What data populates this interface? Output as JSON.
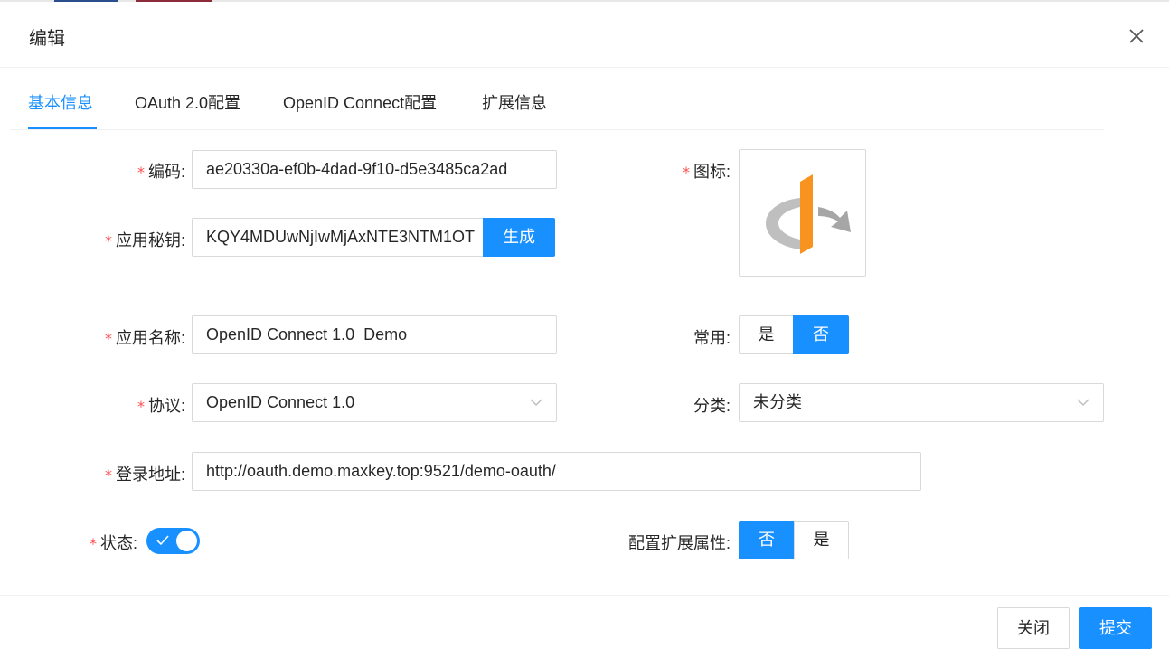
{
  "modal": {
    "title": "编辑"
  },
  "tabs": [
    {
      "label": "基本信息",
      "active": true
    },
    {
      "label": "OAuth 2.0配置"
    },
    {
      "label": "OpenID Connect配置"
    },
    {
      "label": "扩展信息"
    }
  ],
  "form": {
    "required_mark": "*",
    "code": {
      "label": "编码:",
      "value": "ae20330a-ef0b-4dad-9f10-d5e3485ca2ad"
    },
    "secret": {
      "label": "应用秘钥:",
      "value": "KQY4MDUwNjIwMjAxNTE3NTM1OT",
      "generate_label": "生成"
    },
    "icon": {
      "label": "图标:",
      "icon_name": "openid-logo-icon"
    },
    "app_name": {
      "label": "应用名称:",
      "value": "OpenID Connect 1.0  Demo"
    },
    "common": {
      "label": "常用:",
      "options": [
        "是",
        "否"
      ],
      "selected": "否"
    },
    "protocol": {
      "label": "协议:",
      "value": "OpenID Connect 1.0"
    },
    "category": {
      "label": "分类:",
      "value": "未分类"
    },
    "login_url": {
      "label": "登录地址:",
      "value": "http://oauth.demo.maxkey.top:9521/demo-oauth/"
    },
    "status": {
      "label": "状态:",
      "enabled": true
    },
    "ext_attrs": {
      "label": "配置扩展属性:",
      "options": [
        "否",
        "是"
      ],
      "selected": "否"
    }
  },
  "footer": {
    "close_label": "关闭",
    "submit_label": "提交"
  },
  "colors": {
    "primary": "#1890ff",
    "required": "#ff4d4f",
    "border": "#d9d9d9",
    "logo_orange": "#f7931e",
    "logo_gray": "#bfbfbf"
  }
}
